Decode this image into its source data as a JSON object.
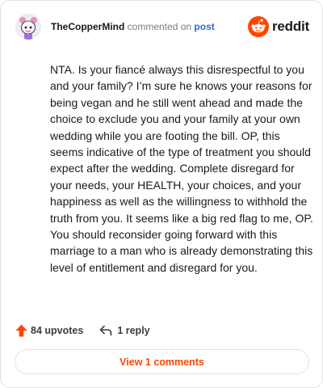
{
  "header": {
    "username": "TheCopperMind",
    "commented_text": "commented on",
    "post_link": "post",
    "brand": "reddit",
    "brand_color": "#ff4500"
  },
  "comment": {
    "body": "NTA. Is your fiancé always this disrespectful to you and your family? I’m sure he knows your reasons for being vegan and he still went ahead and made the choice to exclude you and your family at your own wedding while you are footing the bill. OP, this seems indicative of the type of treatment you should expect after the wedding. Complete disregard for your needs, your HEALTH, your choices, and your happiness as well as the willingness to withhold the truth from you. It seems like a big red flag to me, OP. You should reconsider going forward with this marriage to a man who is already demonstrating this level of entitlement and disregard for you."
  },
  "actions": {
    "upvotes": "84 upvotes",
    "upvote_icon": "upvote-arrow-icon",
    "replies": "1 reply",
    "reply_icon": "reply-arrow-icon"
  },
  "footer": {
    "view_comments": "View 1 comments"
  }
}
